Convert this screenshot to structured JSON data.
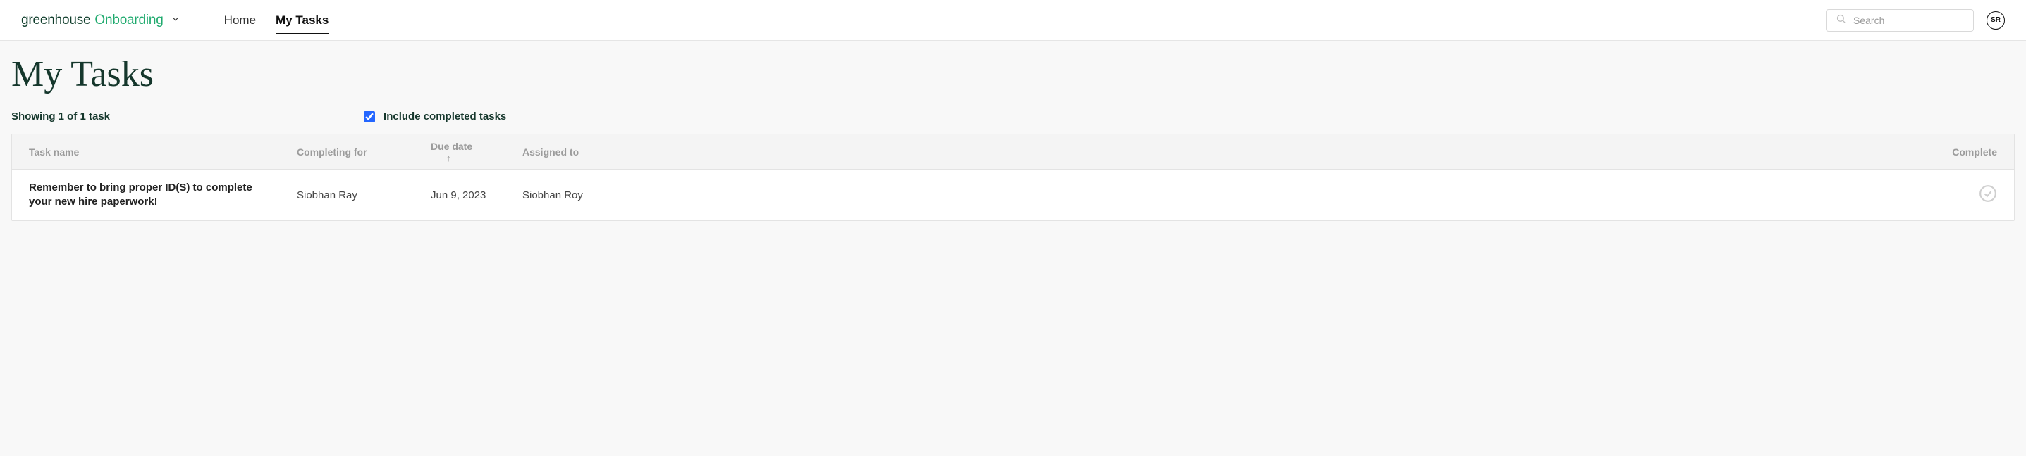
{
  "brand": {
    "greenhouse": "greenhouse",
    "onboarding": "Onboarding"
  },
  "nav": {
    "home": "Home",
    "mytasks": "My Tasks"
  },
  "search": {
    "placeholder": "Search"
  },
  "avatar": {
    "initials": "SR"
  },
  "page": {
    "title": "My Tasks",
    "showing": "Showing 1 of 1 task",
    "include_label": "Include completed tasks",
    "include_checked": true
  },
  "columns": {
    "name": "Task name",
    "for": "Completing for",
    "due": "Due date",
    "assigned": "Assigned to",
    "complete": "Complete"
  },
  "rows": [
    {
      "name": "Remember to bring proper ID(S) to complete your new hire paperwork!",
      "for": "Siobhan Ray",
      "due": "Jun 9, 2023",
      "assigned": "Siobhan Roy"
    }
  ]
}
